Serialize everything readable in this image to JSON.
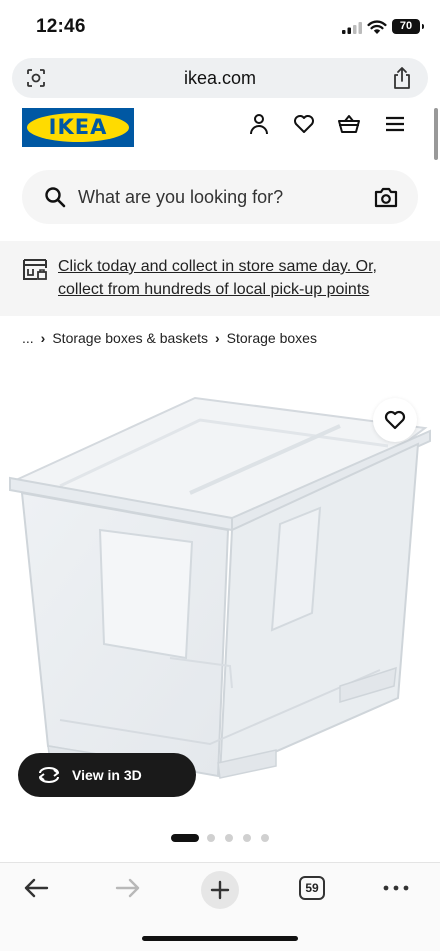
{
  "status_bar": {
    "time": "12:46",
    "battery": "70"
  },
  "browser": {
    "url": "ikea.com",
    "tabs_count": "59"
  },
  "header": {
    "logo_text": "IKEA"
  },
  "search": {
    "placeholder": "What are you looking for?"
  },
  "banner": {
    "text": "Click today and collect in store same day. Or, collect from hundreds of local pick-up points"
  },
  "breadcrumb": {
    "ellipsis": "...",
    "items": [
      "Storage boxes & baskets",
      "Storage boxes"
    ]
  },
  "product": {
    "view3d_label": "View in 3D",
    "image_count": 5,
    "active_image": 1
  },
  "icons": {
    "status": [
      "signal-icon",
      "wifi-icon",
      "battery-icon"
    ],
    "header": [
      "profile-icon",
      "heart-icon",
      "basket-icon",
      "menu-icon"
    ],
    "browser": [
      "back-icon",
      "forward-icon",
      "plus-icon",
      "tabs-icon",
      "more-icon"
    ]
  },
  "colors": {
    "ikea_blue": "#0058a3",
    "ikea_yellow": "#ffdb00",
    "banner_bg": "#f5f5f5",
    "button_dark": "#1a1a1a"
  }
}
